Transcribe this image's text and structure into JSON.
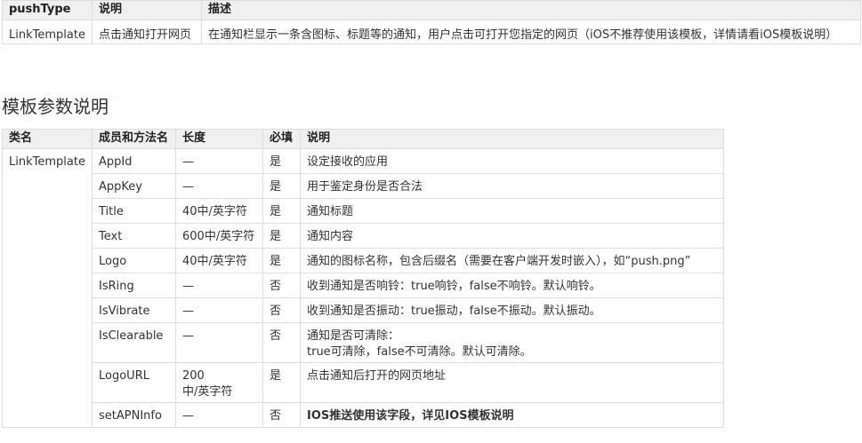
{
  "type_table": {
    "headers": [
      "pushType",
      "说明",
      "描述"
    ],
    "row": [
      "LinkTemplate",
      "点击通知打开网页",
      "在通知栏显示一条含图标、标题等的通知，用户点击可打开您指定的网页（iOS不推荐使用该模板，详情请看iOS模板说明）"
    ]
  },
  "section_title": "模板参数说明",
  "param_table": {
    "headers": [
      "类名",
      "成员和方法名",
      "长度",
      "必填",
      "说明"
    ],
    "class_name": "LinkTemplate",
    "rows": [
      {
        "member": "AppId",
        "length": "—",
        "required": "是",
        "desc": "设定接收的应用"
      },
      {
        "member": "AppKey",
        "length": "—",
        "required": "是",
        "desc": "用于鉴定身份是否合法"
      },
      {
        "member": "Title",
        "length": "40中/英字符",
        "required": "是",
        "desc": "通知标题"
      },
      {
        "member": "Text",
        "length": "600中/英字符",
        "required": "是",
        "desc": "通知内容"
      },
      {
        "member": "Logo",
        "length": "40中/英字符",
        "required": "是",
        "desc": "通知的图标名称，包含后缀名（需要在客户端开发时嵌入），如“push.png”"
      },
      {
        "member": "IsRing",
        "length": "—",
        "required": "否",
        "desc": "收到通知是否响铃：true响铃，false不响铃。默认响铃。"
      },
      {
        "member": "IsVibrate",
        "length": "—",
        "required": "否",
        "desc": "收到通知是否振动：true振动，false不振动。默认振动。"
      },
      {
        "member": "IsClearable",
        "length": "—",
        "required": "否",
        "desc_line1": "通知是否可清除：",
        "desc_line2": "true可清除，false不可清除。默认可清除。"
      },
      {
        "member": "LogoURL",
        "length_line1": "200",
        "length_line2": "中/英字符",
        "required": "是",
        "desc": "点击通知后打开的网页地址"
      },
      {
        "member": "setAPNInfo",
        "length": "—",
        "required": "否",
        "desc": "IOS推送使用该字段，详见IOS模板说明"
      }
    ]
  }
}
